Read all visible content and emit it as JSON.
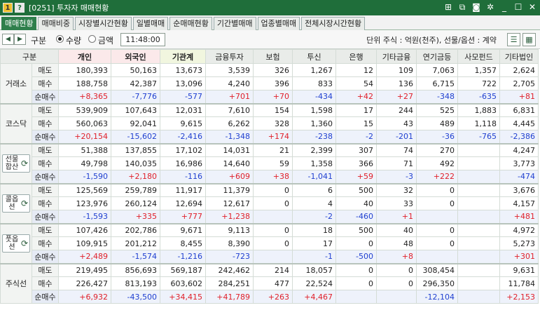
{
  "window": {
    "num_badge": "1",
    "help_badge": "?",
    "title": "[0251] 투자자 매매현황",
    "icons": [
      "link-icon",
      "copy-icon",
      "camera-icon",
      "gear-icon",
      "minimize-icon",
      "maximize-icon",
      "close-icon"
    ],
    "icon_glyphs": [
      "⊞",
      "⧉",
      "◙",
      "✲",
      "_",
      "☐",
      "✕"
    ]
  },
  "tabs": [
    {
      "label": "매매현황",
      "active": true
    },
    {
      "label": "매매비중",
      "active": false
    },
    {
      "label": "시장별시간현황",
      "active": false
    },
    {
      "label": "일별매매",
      "active": false
    },
    {
      "label": "순매매현황",
      "active": false
    },
    {
      "label": "기간별매매",
      "active": false
    },
    {
      "label": "업종별매매",
      "active": false
    },
    {
      "label": "전체시장시간현황",
      "active": false
    }
  ],
  "toolbar": {
    "prev": "◀",
    "next": "▶",
    "type_label": "구분",
    "qty_label": "수량",
    "amount_label": "금액",
    "selected": "qty",
    "time": "11:48:00",
    "unit": "단위 주식 : 억원(천주), 선물/옵션 : 계약"
  },
  "columns": [
    "구분",
    "개인",
    "외국인",
    "기관계",
    "금융투자",
    "보험",
    "투신",
    "은행",
    "기타금융",
    "연기금등",
    "사모펀드",
    "기타법인"
  ],
  "row_labels": [
    "매도",
    "매수",
    "순매수"
  ],
  "groups": [
    {
      "name": "거래소",
      "button": false,
      "rows": [
        [
          "180,393",
          "50,163",
          "13,673",
          "3,539",
          "326",
          "1,267",
          "12",
          "109",
          "7,063",
          "1,357",
          "2,624"
        ],
        [
          "188,758",
          "42,387",
          "13,096",
          "4,240",
          "396",
          "833",
          "54",
          "136",
          "6,715",
          "722",
          "2,705"
        ],
        [
          "+8,365",
          "-7,776",
          "-577",
          "+701",
          "+70",
          "-434",
          "+42",
          "+27",
          "-348",
          "-635",
          "+81"
        ]
      ]
    },
    {
      "name": "코스닥",
      "button": false,
      "rows": [
        [
          "539,909",
          "107,643",
          "12,031",
          "7,610",
          "154",
          "1,598",
          "17",
          "244",
          "525",
          "1,883",
          "6,831"
        ],
        [
          "560,063",
          "92,041",
          "9,615",
          "6,262",
          "328",
          "1,360",
          "15",
          "43",
          "489",
          "1,118",
          "4,445"
        ],
        [
          "+20,154",
          "-15,602",
          "-2,416",
          "-1,348",
          "+174",
          "-238",
          "-2",
          "-201",
          "-36",
          "-765",
          "-2,386"
        ]
      ]
    },
    {
      "name": "선물합산",
      "button": true,
      "rows": [
        [
          "51,388",
          "137,855",
          "17,102",
          "14,031",
          "21",
          "2,399",
          "307",
          "74",
          "270",
          "",
          "4,247"
        ],
        [
          "49,798",
          "140,035",
          "16,986",
          "14,640",
          "59",
          "1,358",
          "366",
          "71",
          "492",
          "",
          "3,773"
        ],
        [
          "-1,590",
          "+2,180",
          "-116",
          "+609",
          "+38",
          "-1,041",
          "+59",
          "-3",
          "+222",
          "",
          "-474"
        ]
      ]
    },
    {
      "name": "콜옵션",
      "button": true,
      "rows": [
        [
          "125,569",
          "259,789",
          "11,917",
          "11,379",
          "0",
          "6",
          "500",
          "32",
          "0",
          "",
          "3,676"
        ],
        [
          "123,976",
          "260,124",
          "12,694",
          "12,617",
          "0",
          "4",
          "40",
          "33",
          "0",
          "",
          "4,157"
        ],
        [
          "-1,593",
          "+335",
          "+777",
          "+1,238",
          "",
          "-2",
          "-460",
          "+1",
          "",
          "",
          "+481"
        ]
      ]
    },
    {
      "name": "풋옵션",
      "button": true,
      "rows": [
        [
          "107,426",
          "202,786",
          "9,671",
          "9,113",
          "0",
          "18",
          "500",
          "40",
          "0",
          "",
          "4,972"
        ],
        [
          "109,915",
          "201,212",
          "8,455",
          "8,390",
          "0",
          "17",
          "0",
          "48",
          "0",
          "",
          "5,273"
        ],
        [
          "+2,489",
          "-1,574",
          "-1,216",
          "-723",
          "",
          "-1",
          "-500",
          "+8",
          "",
          "",
          "+301"
        ]
      ]
    },
    {
      "name": "주식선",
      "button": false,
      "rows": [
        [
          "219,495",
          "856,693",
          "569,187",
          "242,462",
          "214",
          "18,057",
          "0",
          "0",
          "308,454",
          "",
          "9,631"
        ],
        [
          "226,427",
          "813,193",
          "603,602",
          "284,251",
          "477",
          "22,524",
          "0",
          "0",
          "296,350",
          "",
          "11,784"
        ],
        [
          "+6,932",
          "-43,500",
          "+34,415",
          "+41,789",
          "+263",
          "+4,467",
          "",
          "",
          "-12,104",
          "",
          "+2,153"
        ]
      ]
    }
  ]
}
